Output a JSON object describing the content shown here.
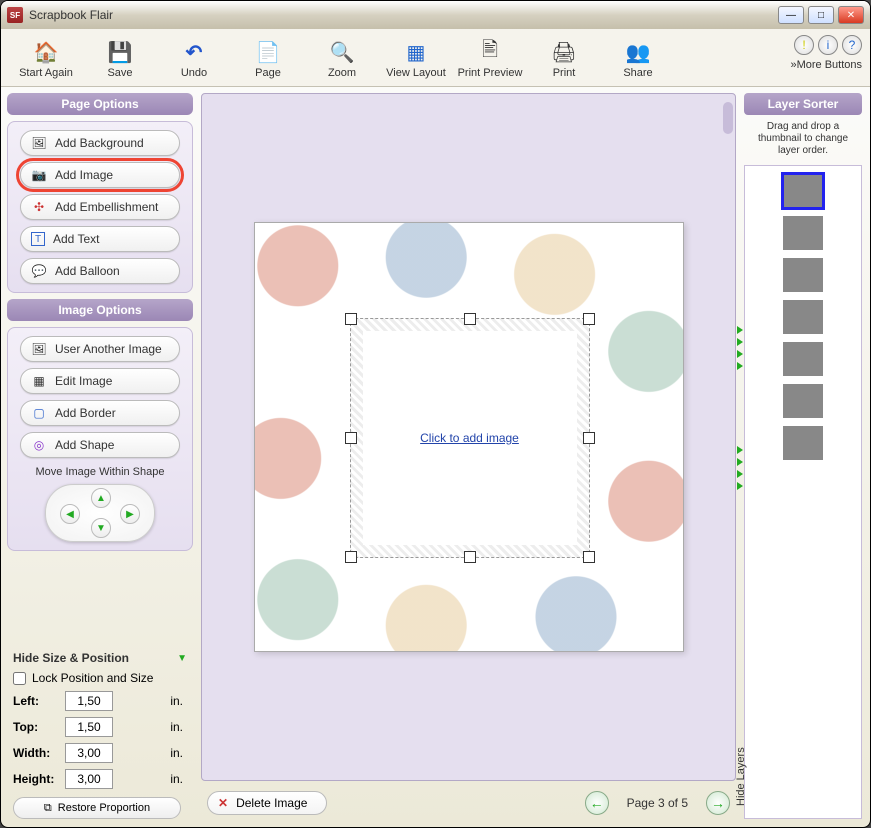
{
  "titlebar": {
    "app_name": "Scrapbook Flair"
  },
  "toolbar": {
    "items": [
      {
        "label": "Start Again",
        "icon": "home-icon",
        "glyph": "🏠"
      },
      {
        "label": "Save",
        "icon": "save-icon",
        "glyph": "💾"
      },
      {
        "label": "Undo",
        "icon": "undo-icon",
        "glyph": "↶"
      },
      {
        "label": "Page",
        "icon": "page-icon",
        "glyph": "📄"
      },
      {
        "label": "Zoom",
        "icon": "zoom-icon",
        "glyph": "🔍"
      },
      {
        "label": "View Layout",
        "icon": "layout-icon",
        "glyph": "▦"
      },
      {
        "label": "Print Preview",
        "icon": "print-preview-icon",
        "glyph": "🖹"
      },
      {
        "label": "Print",
        "icon": "print-icon",
        "glyph": "🖨"
      },
      {
        "label": "Share",
        "icon": "share-icon",
        "glyph": "👥"
      }
    ],
    "help": {
      "hint": "!",
      "info": "i",
      "help": "?"
    },
    "more": "»More Buttons"
  },
  "page_options": {
    "title": "Page Options",
    "buttons": [
      {
        "label": "Add Background",
        "icon": "🖼"
      },
      {
        "label": "Add Image",
        "icon": "📷",
        "highlighted": true
      },
      {
        "label": "Add Embellishment",
        "icon": "✣"
      },
      {
        "label": "Add Text",
        "icon": "T"
      },
      {
        "label": "Add Balloon",
        "icon": "💬"
      }
    ]
  },
  "image_options": {
    "title": "Image Options",
    "buttons": [
      {
        "label": "User Another Image",
        "icon": "🖼"
      },
      {
        "label": "Edit Image",
        "icon": "▦"
      },
      {
        "label": "Add Border",
        "icon": "▢"
      },
      {
        "label": "Add Shape",
        "icon": "◎"
      }
    ],
    "move_label": "Move Image Within Shape"
  },
  "size_position": {
    "title": "Hide Size & Position",
    "lock_label": "Lock Position and Size",
    "left_label": "Left:",
    "left_value": "1,50",
    "top_label": "Top:",
    "top_value": "1,50",
    "width_label": "Width:",
    "width_value": "3,00",
    "height_label": "Height:",
    "height_value": "3,00",
    "unit": "in.",
    "restore_label": "Restore Proportion"
  },
  "canvas": {
    "placeholder_link": "Click to add image",
    "delete_label": "Delete Image",
    "page_info": "Page 3 of 5"
  },
  "layers": {
    "title": "Layer Sorter",
    "hint": "Drag and drop a thumbnail to change layer order.",
    "hide_label": "Hide Layers",
    "count": 7
  }
}
